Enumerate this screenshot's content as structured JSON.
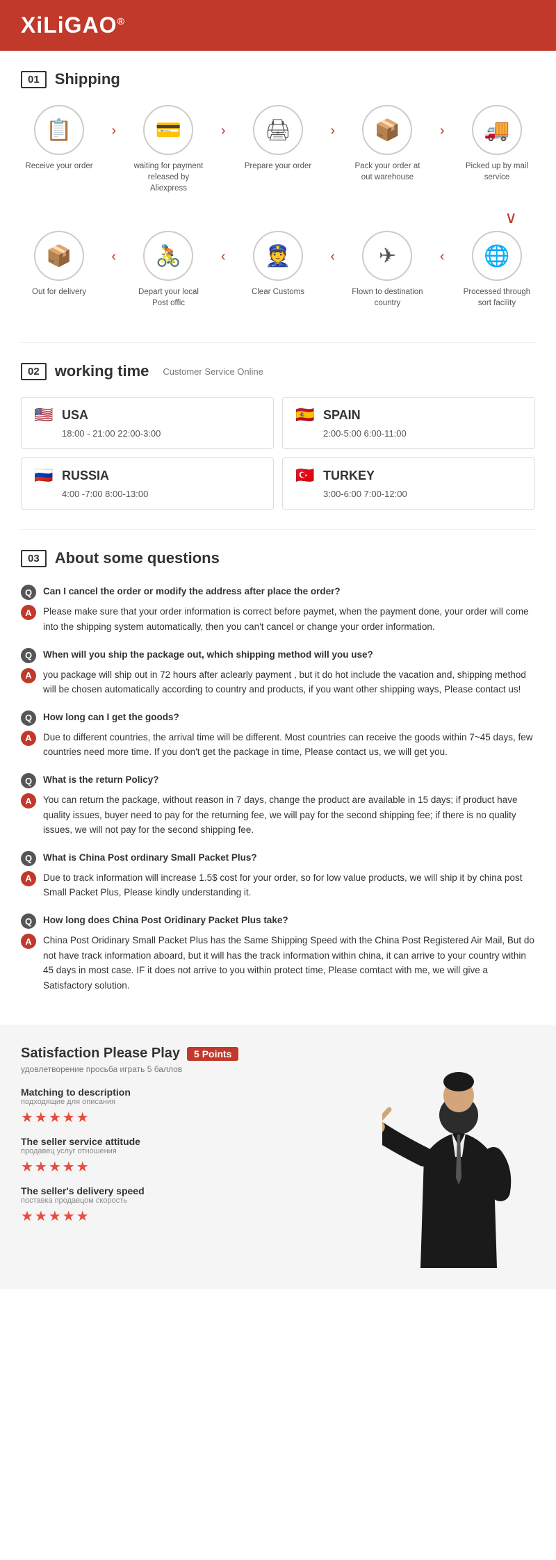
{
  "header": {
    "logo": "XiLiGAO",
    "trademark": "®"
  },
  "shipping": {
    "section_num": "01",
    "section_name": "Shipping",
    "row1": [
      {
        "icon": "📋",
        "label": "Receive your order"
      },
      {
        "arrow": "›"
      },
      {
        "icon": "💳",
        "label": "waiting for payment released by Aliexpress"
      },
      {
        "arrow": "›"
      },
      {
        "icon": "🖨",
        "label": "Prepare your order"
      },
      {
        "arrow": "›"
      },
      {
        "icon": "📦",
        "label": "Pack your order at out warehouse"
      },
      {
        "arrow": "›"
      },
      {
        "icon": "🚚",
        "label": "Picked up by mail service"
      }
    ],
    "arrow_down_right": "↓",
    "row2": [
      {
        "icon": "📦",
        "label": "Out for delivery"
      },
      {
        "arrow": "‹"
      },
      {
        "icon": "🚴",
        "label": "Depart your local Post offic"
      },
      {
        "arrow": "‹"
      },
      {
        "icon": "👮",
        "label": "Clear Customs"
      },
      {
        "arrow": "‹"
      },
      {
        "icon": "✈",
        "label": "Flown to destination country"
      },
      {
        "arrow": "‹"
      },
      {
        "icon": "🌐",
        "label": "Processed through sort facility"
      }
    ]
  },
  "working_time": {
    "section_num": "02",
    "section_name": "working time",
    "section_sub": "Customer Service Online",
    "cards": [
      {
        "flag": "🇺🇸",
        "country": "USA",
        "hours": "18:00 - 21:00   22:00-3:00"
      },
      {
        "flag": "🇪🇸",
        "country": "SPAIN",
        "hours": "2:00-5:00   6:00-11:00"
      },
      {
        "flag": "🇷🇺",
        "country": "RUSSIA",
        "hours": "4:00 -7:00   8:00-13:00"
      },
      {
        "flag": "🇹🇷",
        "country": "TURKEY",
        "hours": "3:00-6:00   7:00-12:00"
      }
    ]
  },
  "questions": {
    "section_num": "03",
    "section_name": "About some questions",
    "items": [
      {
        "q": "Can I cancel the order or modify the address after place the order?",
        "a": "Please make sure that your order information is correct before paymet, when the payment done, your order will come into the shipping system automatically, then you can't cancel or change your order information."
      },
      {
        "q": "When will you ship the package out, which shipping method will you use?",
        "a": "you package will ship out in 72 hours after aclearly payment , but it do hot include the vacation and, shipping method will be chosen automatically according to country and products, if you want other shipping ways, Please contact us!"
      },
      {
        "q": "How long can I get the goods?",
        "a": "Due to different countries, the arrival time will be different. Most countries can receive the goods within 7~45 days, few countries need more time. If you don't get the package in time, Please contact us, we will get you."
      },
      {
        "q": "What is the return Policy?",
        "a": "You can return the package, without reason in 7 days, change the product are available in 15 days; if product have quality issues, buyer need to pay for the returning fee, we will pay for the second shipping fee; if there is no quality issues, we will not pay for the second shipping fee."
      },
      {
        "q": "What is China Post ordinary Small Packet Plus?",
        "a": "Due to track information will increase 1.5$ cost for your order, so for low value products, we will ship it by china post Small Packet Plus, Please kindly understanding it."
      },
      {
        "q": "How long does China Post Oridinary Packet Plus take?",
        "a": "China Post Oridinary Small Packet Plus has the Same Shipping Speed with the China Post Registered Air Mail, But do not have track information aboard, but it will has the track information within china, it can arrive to your country within 45 days in most case. IF it does not arrive to you within protect time, Please comtact with me, we will give a Satisfactory solution."
      }
    ]
  },
  "satisfaction": {
    "title": "Satisfaction Please Play",
    "points_badge": "5 Points",
    "subtitle_ru": "удовлетворение просьба играть 5 баллов",
    "ratings": [
      {
        "label_en": "Matching to description",
        "label_ru": "подходящие для описания",
        "stars": "★★★★★"
      },
      {
        "label_en": "The seller service attitude",
        "label_ru": "продавец услуг отношения",
        "stars": "★★★★★"
      },
      {
        "label_en": "The seller's delivery speed",
        "label_ru": "поставка продавцом скорость",
        "stars": "★★★★★"
      }
    ]
  }
}
